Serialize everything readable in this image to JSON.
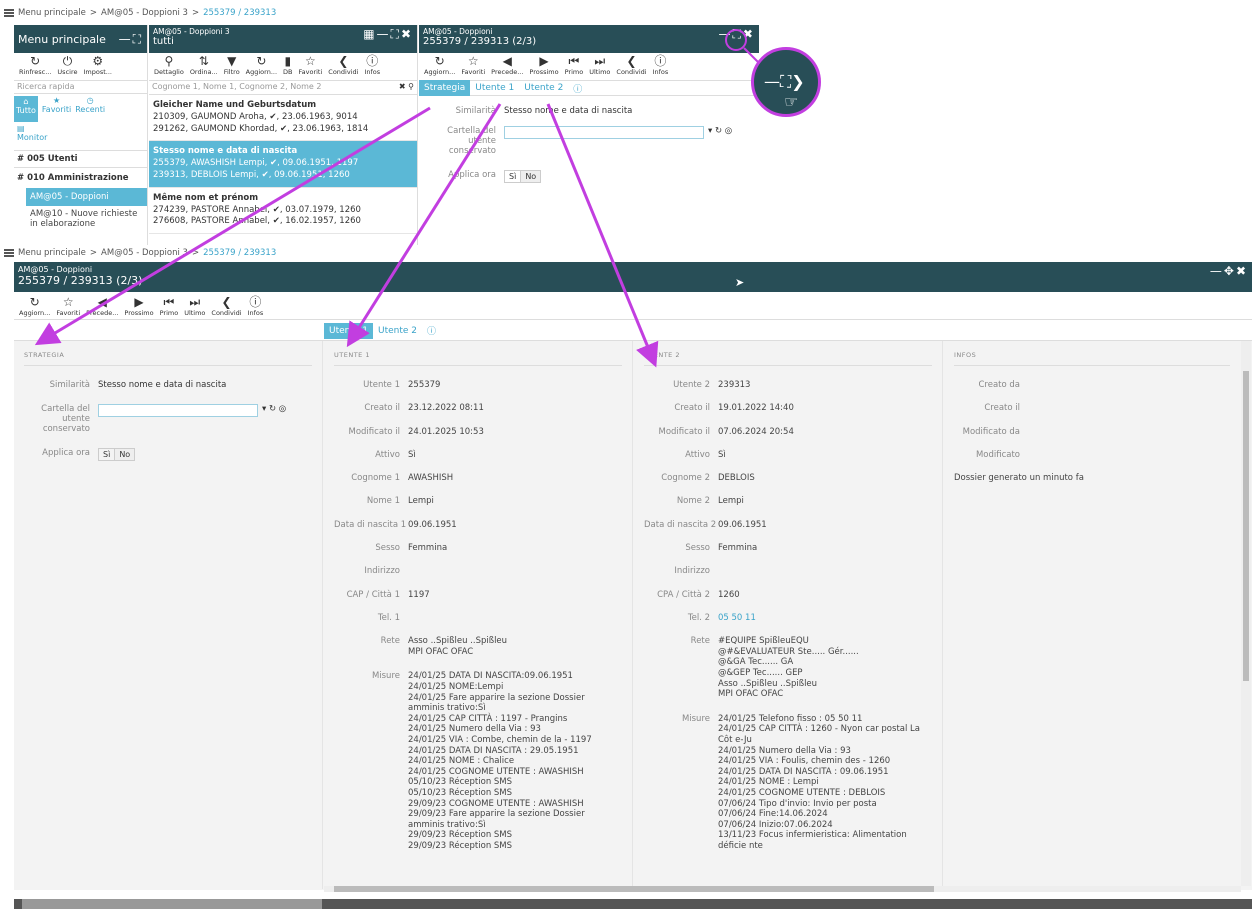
{
  "top": {
    "breadcrumb": {
      "root": "Menu principale",
      "sep1": ">",
      "item1": "AM@05 - Doppioni 3",
      "sep2": ">",
      "item2": "255379 / 239313"
    },
    "menu": {
      "title": "Menu principale",
      "toolbar": [
        "Rinfresc...",
        "Uscire",
        "Impost..."
      ],
      "search_placeholder": "Ricerca rapida",
      "tabs": [
        "Tutto",
        "Favoriti",
        "Recenti"
      ],
      "monitor": "Monitor",
      "items": [
        "# 005 Utenti",
        "# 010 Amministrazione"
      ],
      "subitems": [
        "AM@05 - Doppioni",
        "AM@10 - Nuove richieste in elaborazione"
      ]
    },
    "list": {
      "title": "AM@05 - Doppioni 3",
      "subtitle": "tutti",
      "toolbar": [
        "Dettaglio",
        "Ordina...",
        "Filtro",
        "Aggiorn...",
        "DB",
        "Favoriti",
        "Condividi",
        "Infos"
      ],
      "search_placeholder": "Cognome 1, Nome 1, Cognome 2, Nome 2",
      "groups": [
        {
          "title": "Gleicher Name und Geburtsdatum",
          "lines": [
            "210309, GAUMOND Aroha, ✔, 23.06.1963, 9014",
            "291262, GAUMOND Khordad, ✔, 23.06.1963, 1814"
          ]
        },
        {
          "title": "Stesso nome e data di nascita",
          "lines": [
            "255379, AWASHISH Lempi, ✔, 09.06.1951, 1197",
            "239313, DEBLOIS Lempi, ✔, 09.06.1951, 1260"
          ]
        },
        {
          "title": "Même nom et prénom",
          "lines": [
            "274239, PASTORE Annabel, ✔, 03.07.1979, 1260",
            "276608, PASTORE Annabel, ✔, 16.02.1957, 1260"
          ]
        }
      ]
    },
    "detail": {
      "title": "AM@05 - Doppioni",
      "subtitle": "255379 / 239313 (2/3)",
      "toolbar": [
        "Aggiorn...",
        "Favoriti",
        "Precede...",
        "Prossimo",
        "Primo",
        "Ultimo",
        "Condividi",
        "Infos"
      ],
      "tabs": [
        "Strategia",
        "Utente 1",
        "Utente 2"
      ],
      "similarity_label": "Similarità",
      "similarity_value": "Stesso nome e data di nascita",
      "cartella_label": "Cartella del utente conservato",
      "applica_label": "Applica ora",
      "si": "Sì",
      "no": "No"
    }
  },
  "main": {
    "breadcrumb": {
      "root": "Menu principale",
      "sep1": ">",
      "item1": "AM@05 - Doppioni 3",
      "sep2": ">",
      "item2": "255379 / 239313"
    },
    "title": "AM@05 - Doppioni",
    "subtitle": "255379 / 239313 (2/3)",
    "toolbar": [
      "Aggiorn...",
      "Favoriti",
      "Precede...",
      "Prossimo",
      "Primo",
      "Ultimo",
      "Condividi",
      "Infos"
    ],
    "tabs": [
      "Utente 1",
      "Utente 2"
    ],
    "strategia": {
      "header": "STRATEGIA",
      "similarity_label": "Similarità",
      "similarity_value": "Stesso nome e data di nascita",
      "cartella_label": "Cartella del utente conservato",
      "applica_label": "Applica ora",
      "si": "Sì",
      "no": "No"
    },
    "utente1": {
      "header": "UTENTE 1",
      "fields": [
        {
          "k": "Utente 1",
          "v": "255379"
        },
        {
          "k": "Creato il",
          "v": "23.12.2022 08:11"
        },
        {
          "k": "Modificato il",
          "v": "24.01.2025 10:53"
        },
        {
          "k": "Attivo",
          "v": "Sì"
        },
        {
          "k": "Cognome 1",
          "v": "AWASHISH"
        },
        {
          "k": "Nome 1",
          "v": "Lempi"
        },
        {
          "k": "Data di nascita 1",
          "v": "09.06.1951"
        },
        {
          "k": "Sesso",
          "v": "Femmina"
        },
        {
          "k": "Indirizzo",
          "v": ""
        },
        {
          "k": "CAP / Città 1",
          "v": "1197"
        },
        {
          "k": "Tel. 1",
          "v": ""
        }
      ],
      "rete_label": "Rete",
      "rete": [
        "Asso ..Spißleu ..Spißleu",
        "MPI OFAC OFAC"
      ],
      "misure_label": "Misure",
      "misure": [
        "24/01/25 DATA DI NASCITA:09.06.1951",
        "24/01/25 NOME:Lempi",
        "24/01/25 Fare apparire la sezione Dossier amminis trativo:Sì",
        "24/01/25 CAP CITTÀ : 1197 - Prangins",
        "24/01/25 Numero della Via : 93",
        "24/01/25 VIA : Combe, chemin de la - 1197",
        "24/01/25 DATA DI NASCITA : 29.05.1951",
        "24/01/25 NOME : Chalice",
        "24/01/25 COGNOME UTENTE : AWASHISH",
        "05/10/23 Réception SMS",
        "05/10/23 Réception SMS",
        "29/09/23 COGNOME UTENTE : AWASHISH",
        "29/09/23 Fare apparire la sezione Dossier amminis trativo:Sì",
        "29/09/23 Réception SMS",
        "29/09/23 Réception SMS"
      ]
    },
    "utente2": {
      "header": "UTENTE 2",
      "fields": [
        {
          "k": "Utente 2",
          "v": "239313"
        },
        {
          "k": "Creato il",
          "v": "19.01.2022 14:40"
        },
        {
          "k": "Modificato il",
          "v": "07.06.2024 20:54"
        },
        {
          "k": "Attivo",
          "v": "Sì"
        },
        {
          "k": "Cognome 2",
          "v": "DEBLOIS"
        },
        {
          "k": "Nome 2",
          "v": "Lempi"
        },
        {
          "k": "Data di nascita 2",
          "v": "09.06.1951"
        },
        {
          "k": "Sesso",
          "v": "Femmina"
        },
        {
          "k": "Indirizzo",
          "v": ""
        },
        {
          "k": "CPA / Città 2",
          "v": "1260"
        },
        {
          "k": "Tel. 2",
          "v": "05 50 11"
        }
      ],
      "rete_label": "Rete",
      "rete": [
        "#EQUIPE SpißleuEQU",
        "@#&EVALUATEUR Ste..... Gér......",
        "@&GA Tec...... GA",
        "@&GEP Tec...... GEP",
        "Asso ..Spißleu ..Spißleu",
        "MPI OFAC OFAC"
      ],
      "misure_label": "Misure",
      "misure": [
        "24/01/25 Telefono fisso : 05 50 11",
        "24/01/25 CAP CITTÀ : 1260 - Nyon car postal La Côt e-Ju",
        "24/01/25 Numero della Via : 93",
        "24/01/25 VIA : Foulis, chemin des - 1260",
        "24/01/25 DATA DI NASCITA : 09.06.1951",
        "24/01/25 NOME : Lempi",
        "24/01/25 COGNOME UTENTE : DEBLOIS",
        "07/06/24 Tipo d'invio: Invio per posta",
        "07/06/24 Fine:14.06.2024",
        "07/06/24 Inizio:07.06.2024",
        "13/11/23 Focus infermieristica: Alimentation déficie nte"
      ]
    },
    "infos": {
      "header": "INFOS",
      "fields": [
        {
          "k": "Creato da",
          "v": ""
        },
        {
          "k": "Creato il",
          "v": ""
        },
        {
          "k": "Modificato da",
          "v": ""
        },
        {
          "k": "Modificato",
          "v": ""
        }
      ],
      "note": "Dossier generato un minuto fa"
    }
  },
  "colors": {
    "teal": "#284e57",
    "accent": "#5bb8d6",
    "arrow": "#c23ee0"
  }
}
